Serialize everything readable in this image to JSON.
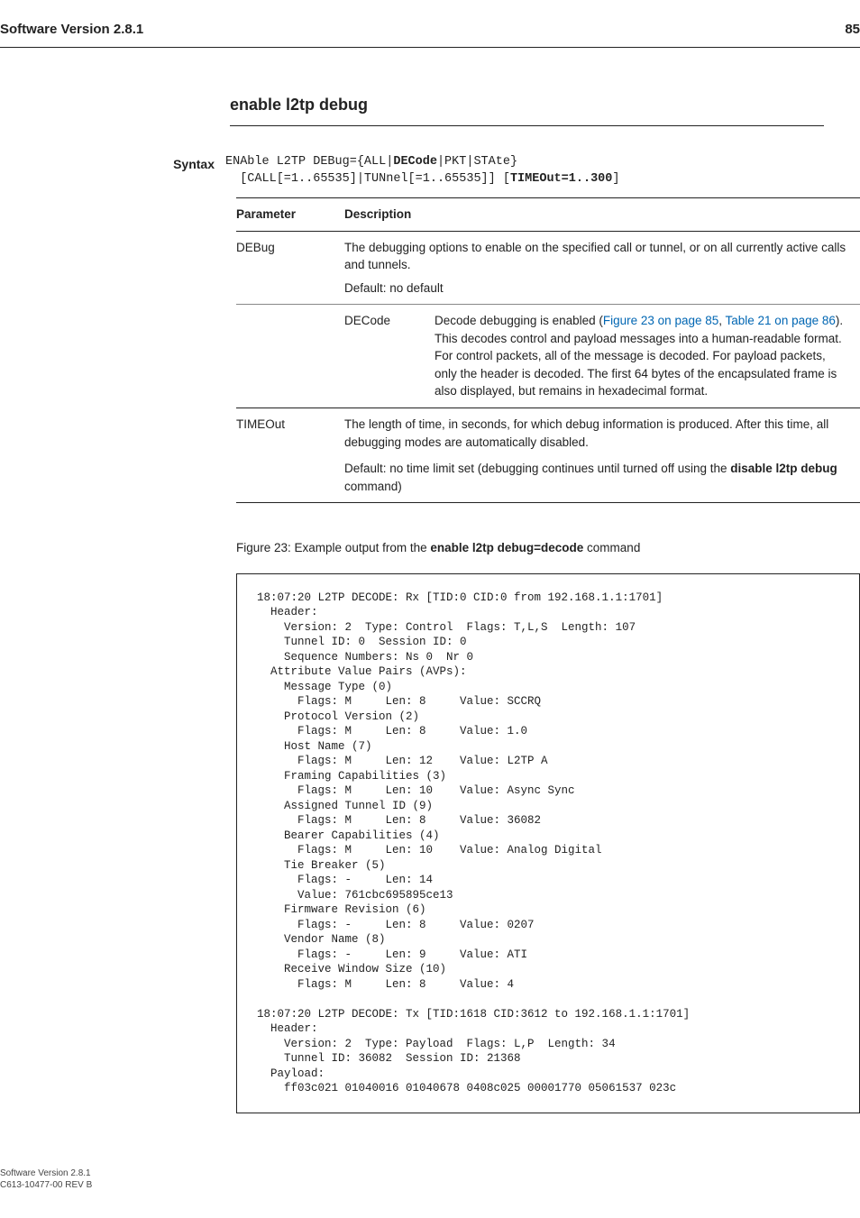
{
  "header": {
    "title": "Software Version 2.8.1",
    "page": "85"
  },
  "command": {
    "heading": "enable l2tp debug"
  },
  "syntax": {
    "label": "Syntax",
    "line1_pre": "ENAble L2TP DEBug={ALL|",
    "line1_bold": "DECode",
    "line1_post": "|PKT|STAte}",
    "line2_pre": "  [CALL[=1..65535]|TUNnel[=1..65535]] [",
    "line2_bold": "TIMEOut=1..300",
    "line2_post": "]"
  },
  "table": {
    "head_param": "Parameter",
    "head_desc": "Description",
    "rows": [
      {
        "param": "DEBug",
        "desc": "The debugging options to enable on the specified call or tunnel, or on all currently active calls and tunnels.",
        "default": "Default: no default"
      }
    ],
    "subrow": {
      "left": "DECode",
      "pre": "Decode debugging is enabled (",
      "link1": "Figure 23 on page 85",
      "mid": ", ",
      "link2": "Table 21 on page 86",
      "post": "). This decodes control and payload messages into a human-readable format. For control packets, all of the message is decoded. For payload packets, only the header is decoded. The first 64 bytes of the encapsulated frame is also displayed, but remains in hexadecimal format."
    },
    "timeout": {
      "param": "TIMEOut",
      "desc": "The length of time, in seconds, for which debug information is produced. After this time, all debugging modes are automatically disabled.",
      "default_pre": "Default: no time limit set (debugging continues until turned off using the ",
      "default_bold": "disable l2tp debug",
      "default_post": " command)"
    }
  },
  "figure": {
    "caption_pre": "Figure 23: Example output from the ",
    "caption_bold": "enable l2tp debug=decode",
    "caption_post": " command"
  },
  "output": "18:07:20 L2TP DECODE: Rx [TID:0 CID:0 from 192.168.1.1:1701]\n  Header:\n    Version: 2  Type: Control  Flags: T,L,S  Length: 107\n    Tunnel ID: 0  Session ID: 0\n    Sequence Numbers: Ns 0  Nr 0\n  Attribute Value Pairs (AVPs):\n    Message Type (0)\n      Flags: M     Len: 8     Value: SCCRQ\n    Protocol Version (2)\n      Flags: M     Len: 8     Value: 1.0\n    Host Name (7)\n      Flags: M     Len: 12    Value: L2TP A\n    Framing Capabilities (3)\n      Flags: M     Len: 10    Value: Async Sync\n    Assigned Tunnel ID (9)\n      Flags: M     Len: 8     Value: 36082\n    Bearer Capabilities (4)\n      Flags: M     Len: 10    Value: Analog Digital\n    Tie Breaker (5)\n      Flags: -     Len: 14\n      Value: 761cbc695895ce13\n    Firmware Revision (6)\n      Flags: -     Len: 8     Value: 0207\n    Vendor Name (8)\n      Flags: -     Len: 9     Value: ATI\n    Receive Window Size (10)\n      Flags: M     Len: 8     Value: 4\n\n18:07:20 L2TP DECODE: Tx [TID:1618 CID:3612 to 192.168.1.1:1701]\n  Header:\n    Version: 2  Type: Payload  Flags: L,P  Length: 34\n    Tunnel ID: 36082  Session ID: 21368\n  Payload:\n    ff03c021 01040016 01040678 0408c025 00001770 05061537 023c",
  "footer": {
    "line1": "Software Version 2.8.1",
    "line2": "C613-10477-00 REV B"
  }
}
